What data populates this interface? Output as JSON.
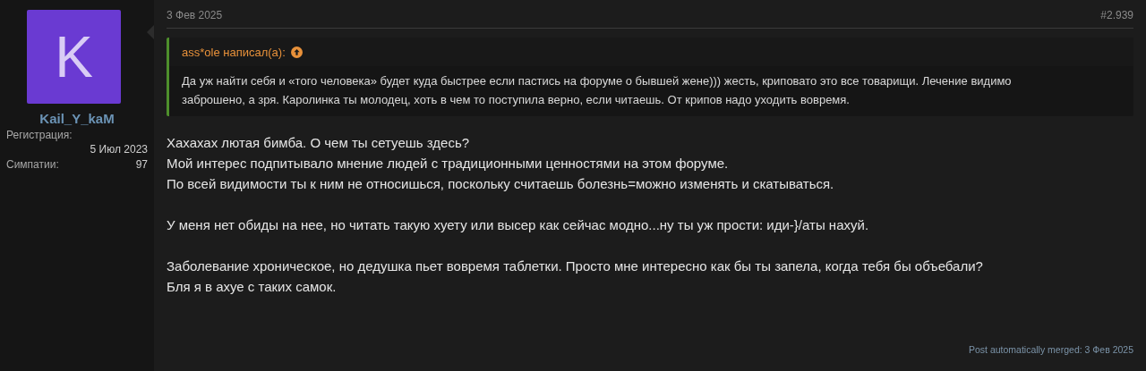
{
  "author": {
    "avatar_letter": "K",
    "username": "Kail_Y_kaM",
    "stats": [
      {
        "label": "Регистрация:",
        "value": "5 Июл 2023",
        "kind": "stacked"
      },
      {
        "label": "Симпатии:",
        "value": "97",
        "kind": "inline"
      }
    ]
  },
  "post": {
    "date": "3 Фев 2025",
    "number": "#2.939",
    "quote": {
      "author": "ass*ole написал(а):",
      "lines": [
        "Да уж найти себя и «того человека» будет куда быстрее если пастись на форуме о бывшей жене))) жесть, криповато это все товарищи. Лечение видимо",
        "заброшено, а зря. Каролинка ты молодец, хоть в чем то поступила верно, если читаешь. От крипов надо уходить вовремя."
      ]
    },
    "paragraphs": [
      {
        "lines": [
          "Хахахах лютая бимба. О чем ты сетуешь здесь?",
          "Мой интерес подпитывало мнение людей с традиционными ценностями на этом форуме.",
          "По всей видимости ты к ним не относишься, поскольку считаешь болезнь=можно изменять и скатываться."
        ]
      },
      {
        "lines": [
          "У меня нет обиды на нее, но читать такую хуету или высер как сейчас модно...ну ты уж прости: иди-}/аты нахуй."
        ]
      },
      {
        "lines": [
          "Заболевание хроническое, но дедушка пьет вовремя таблетки. Просто мне интересно как бы ты запела, когда тебя бы объебали?",
          "Бля я в ахуе с таких самок."
        ]
      }
    ],
    "merged_note": "Post automatically merged: 3 Фев 2025"
  }
}
